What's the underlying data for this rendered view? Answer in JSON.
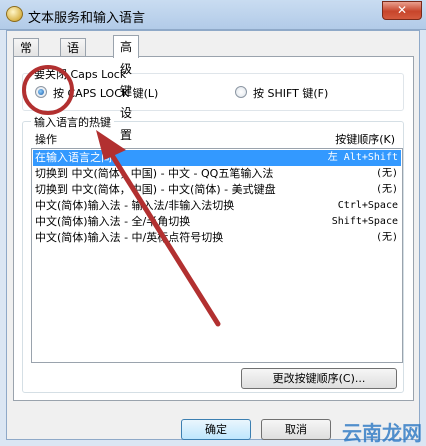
{
  "window": {
    "title": "文本服务和输入语言",
    "close_glyph": "✕"
  },
  "tabs": [
    "常规",
    "语言栏",
    "高级键设置"
  ],
  "caps_group": {
    "legend": "要关闭 Caps Lock",
    "option_caps": "按 CAPS LOCK 键(L)",
    "option_shift": "按 SHIFT 键(F)",
    "selected": "caps"
  },
  "hotkeys": {
    "legend": "输入语言的热键",
    "col_action": "操作",
    "col_keys": "按键顺序(K)",
    "rows": [
      {
        "action": "在输入语言之间",
        "keys": "左 Alt+Shift",
        "selected": true
      },
      {
        "action": "切换到 中文(简体，中国) - 中文 - QQ五笔输入法",
        "keys": "(无)",
        "selected": false
      },
      {
        "action": "切换到 中文(简体，中国) - 中文(简体) - 美式键盘",
        "keys": "(无)",
        "selected": false
      },
      {
        "action": "中文(简体)输入法 - 输入法/非输入法切换",
        "keys": "Ctrl+Space",
        "selected": false
      },
      {
        "action": "中文(简体)输入法 - 全/半角切换",
        "keys": "Shift+Space",
        "selected": false
      },
      {
        "action": "中文(简体)输入法 - 中/英标点符号切换",
        "keys": "(无)",
        "selected": false
      }
    ],
    "change_button": "更改按键顺序(C)..."
  },
  "footer": {
    "ok": "确定",
    "cancel": "取消"
  },
  "watermark": "云南龙网",
  "annotation_color": "#b23030"
}
